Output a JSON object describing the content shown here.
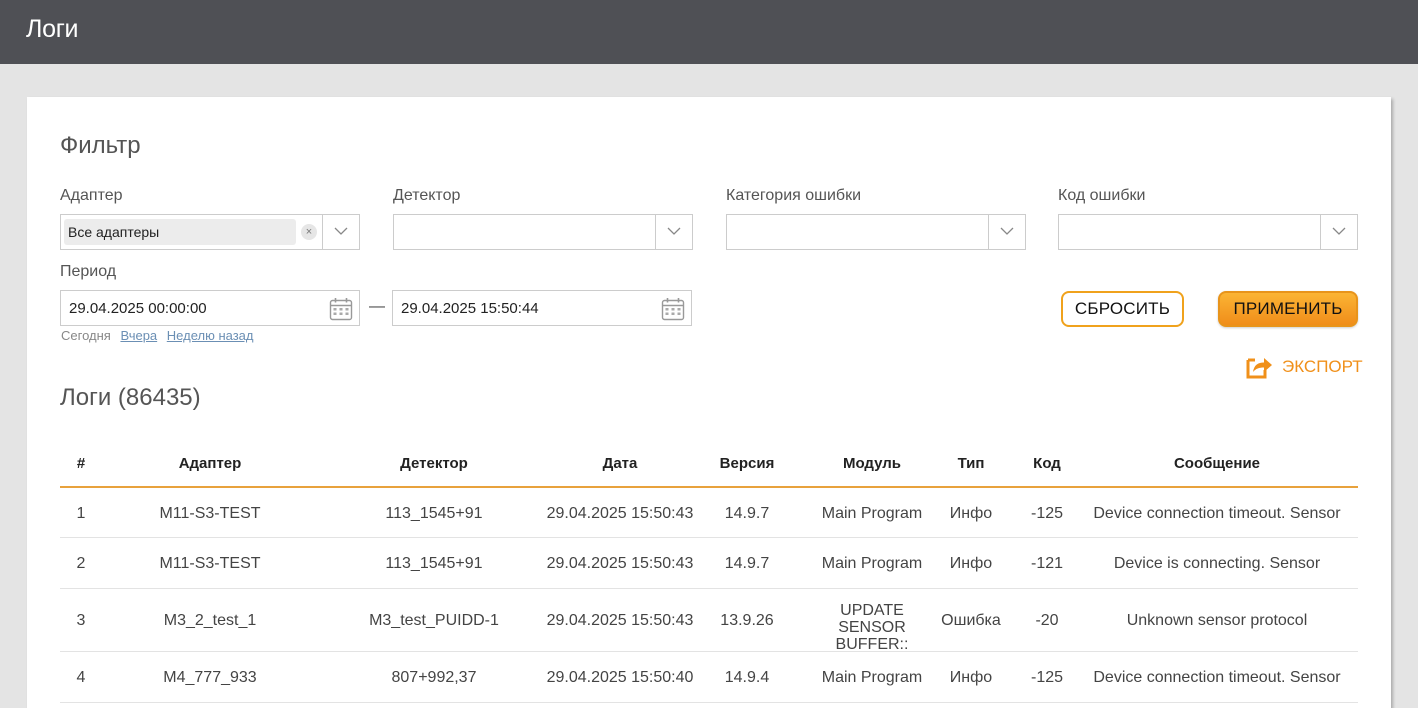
{
  "header": {
    "title": "Логи"
  },
  "filter": {
    "title": "Фильтр",
    "adapter": {
      "label": "Адаптер",
      "selected": "Все адаптеры",
      "clear": "×"
    },
    "detector": {
      "label": "Детектор",
      "value": ""
    },
    "error_category": {
      "label": "Категория ошибки",
      "value": ""
    },
    "error_code": {
      "label": "Код ошибки",
      "value": ""
    },
    "period": {
      "label": "Период",
      "from": "29.04.2025 00:00:00",
      "separator": "—",
      "to": "29.04.2025 15:50:44",
      "quick_today": "Сегодня",
      "quick_yesterday": "Вчера",
      "quick_week": "Неделю назад"
    },
    "reset_label": "СБРОСИТЬ",
    "apply_label": "ПРИМЕНИТЬ",
    "export_label": "ЭКСПОРТ"
  },
  "logs": {
    "title": "Логи (86435)",
    "columns": [
      "#",
      "Адаптер",
      "Детектор",
      "Дата",
      "Версия",
      "Модуль",
      "Тип",
      "Код",
      "Сообщение"
    ],
    "rows": [
      [
        "1",
        "M11-S3-TEST",
        "113_1545+91",
        "29.04.2025 15:50:43",
        "14.9.7",
        "Main Program",
        "Инфо",
        "-125",
        "Device connection timeout. Sensor"
      ],
      [
        "2",
        "M11-S3-TEST",
        "113_1545+91",
        "29.04.2025 15:50:43",
        "14.9.7",
        "Main Program",
        "Инфо",
        "-121",
        "Device is connecting. Sensor"
      ],
      [
        "3",
        "M3_2_test_1",
        "M3_test_PUIDD-1",
        "29.04.2025 15:50:43",
        "13.9.26",
        "UPDATE SENSOR BUFFER::",
        "Ошибка",
        "-20",
        "Unknown sensor protocol"
      ],
      [
        "4",
        "M4_777_933",
        "807+992,37",
        "29.04.2025 15:50:40",
        "14.9.4",
        "Main Program",
        "Инфо",
        "-125",
        "Device connection timeout. Sensor"
      ]
    ]
  },
  "colors": {
    "accent": "#f0901a",
    "topbar": "#4f5055",
    "background": "#e4e4e4"
  },
  "icons": {
    "calendar": "calendar-icon",
    "chevron": "chevron-down-icon",
    "export": "export-icon"
  }
}
